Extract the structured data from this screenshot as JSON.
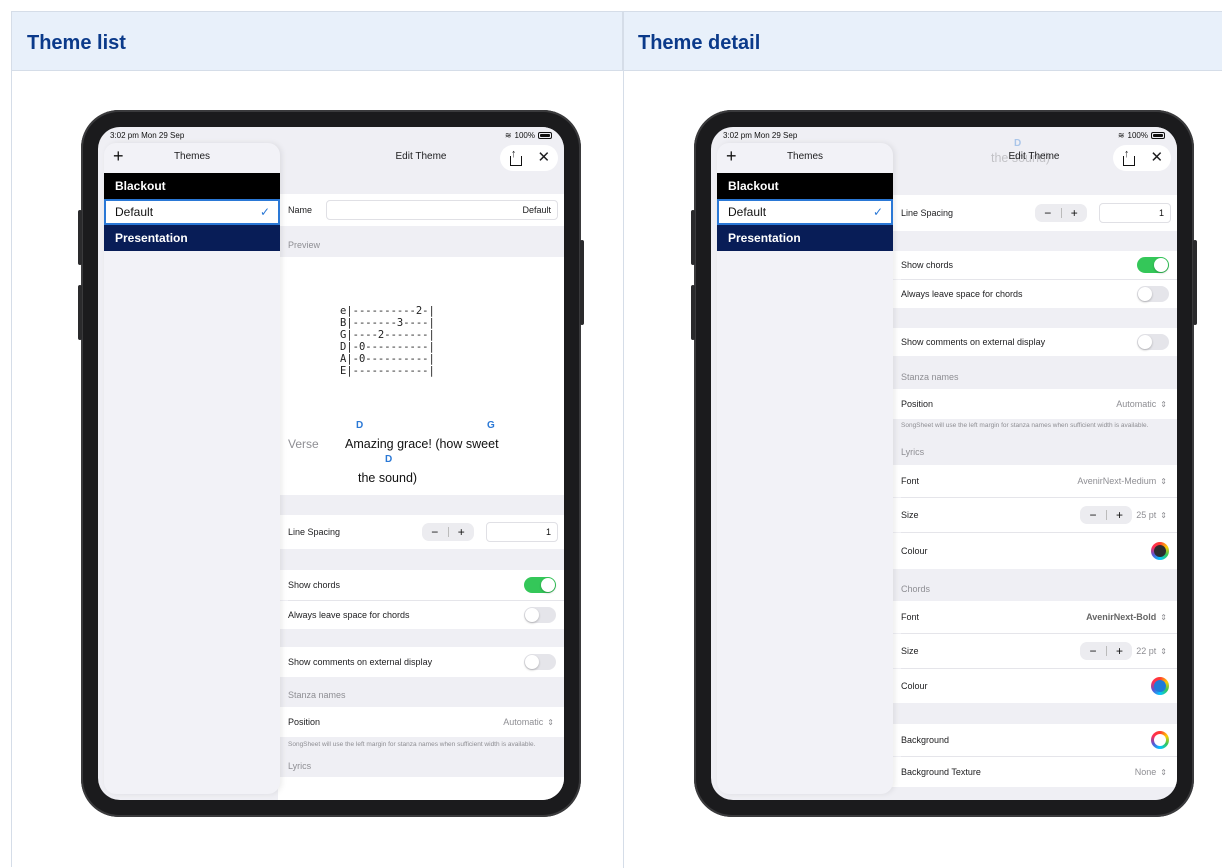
{
  "columns": {
    "left_heading": "Theme list",
    "right_heading": "Theme detail"
  },
  "status_bar": {
    "time": "3:02 pm  Mon 29 Sep",
    "battery": "100%"
  },
  "sidebar": {
    "add": "+",
    "title": "Themes",
    "themes": [
      "Blackout",
      "Default",
      "Presentation"
    ],
    "selected_check": "✓"
  },
  "nav": {
    "title": "Edit Theme",
    "close": "✕"
  },
  "left_screen": {
    "name_label": "Name",
    "name_value": "Default",
    "preview_label": "Preview",
    "tab_lines": [
      "e|----------2-|",
      "B|-------3----|",
      "G|----2-------|",
      "D|-0----------|",
      "A|-0----------|",
      "E|------------|"
    ],
    "verse_label": "Verse",
    "chord1": "D",
    "chord2": "G",
    "chord3": "D",
    "lyric1": "Amazing grace! (how sweet",
    "lyric2": "the sound)",
    "line_spacing_label": "Line Spacing",
    "line_spacing_value": "1",
    "show_chords_label": "Show chords",
    "always_space_label": "Always leave space for chords",
    "show_comments_label": "Show comments on external display",
    "stanza_header": "Stanza names",
    "position_label": "Position",
    "position_value": "Automatic",
    "stanza_note": "SongSheet will use the left margin for stanza names when sufficient width is available.",
    "lyrics_header": "Lyrics"
  },
  "right_screen": {
    "ghost_chord": "D",
    "ghost_lyric": "the sound)",
    "line_spacing_label": "Line Spacing",
    "line_spacing_value": "1",
    "show_chords_label": "Show chords",
    "always_space_label": "Always leave space for chords",
    "show_comments_label": "Show comments on external display",
    "stanza_header": "Stanza names",
    "position_label": "Position",
    "position_value": "Automatic",
    "stanza_note": "SongSheet will use the left margin for stanza names when sufficient width is available.",
    "lyrics_header": "Lyrics",
    "lyrics_font_label": "Font",
    "lyrics_font_value": "AvenirNext-Medium",
    "lyrics_size_label": "Size",
    "lyrics_size_value": "25 pt",
    "lyrics_colour_label": "Colour",
    "chords_header": "Chords",
    "chords_font_label": "Font",
    "chords_font_value": "AvenirNext-Bold",
    "chords_size_label": "Size",
    "chords_size_value": "22 pt",
    "chords_colour_label": "Colour",
    "background_label": "Background",
    "texture_label": "Background Texture",
    "texture_value": "None"
  },
  "stepper": {
    "minus": "−",
    "plus": "+"
  },
  "colors": {
    "accent": "#2a78d6",
    "heading": "#0b3a8a",
    "toggle_on": "#34c759",
    "lyrics_colour": "#2b2b2e",
    "chords_colour": "#1f7ad8",
    "background_colour": "#ffffff"
  }
}
